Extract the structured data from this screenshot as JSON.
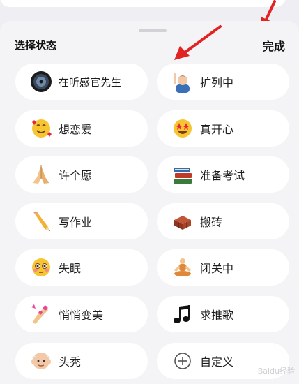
{
  "header": {
    "title": "选择状态",
    "done_label": "完成"
  },
  "statuses": [
    {
      "label": "在听感官先生",
      "icon": "record-disc-icon"
    },
    {
      "label": "扩列中",
      "icon": "person-raising-hand-icon"
    },
    {
      "label": "想恋爱",
      "icon": "smiling-face-with-hearts-icon"
    },
    {
      "label": "真开心",
      "icon": "star-struck-face-icon"
    },
    {
      "label": "许个愿",
      "icon": "folded-hands-icon"
    },
    {
      "label": "准备考试",
      "icon": "books-icon"
    },
    {
      "label": "写作业",
      "icon": "pencil-icon"
    },
    {
      "label": "搬砖",
      "icon": "bricks-icon"
    },
    {
      "label": "失眠",
      "icon": "flushed-face-icon"
    },
    {
      "label": "闭关中",
      "icon": "meditating-person-icon"
    },
    {
      "label": "悄悄变美",
      "icon": "nail-polish-icon"
    },
    {
      "label": "求推歌",
      "icon": "music-note-icon"
    },
    {
      "label": "头秃",
      "icon": "bald-old-man-icon"
    },
    {
      "label": "自定义",
      "icon": "plus-circle-icon"
    }
  ],
  "colors": {
    "annotation_arrow": "#e32222",
    "background": "#f4f4f6",
    "pill": "#ffffff"
  }
}
